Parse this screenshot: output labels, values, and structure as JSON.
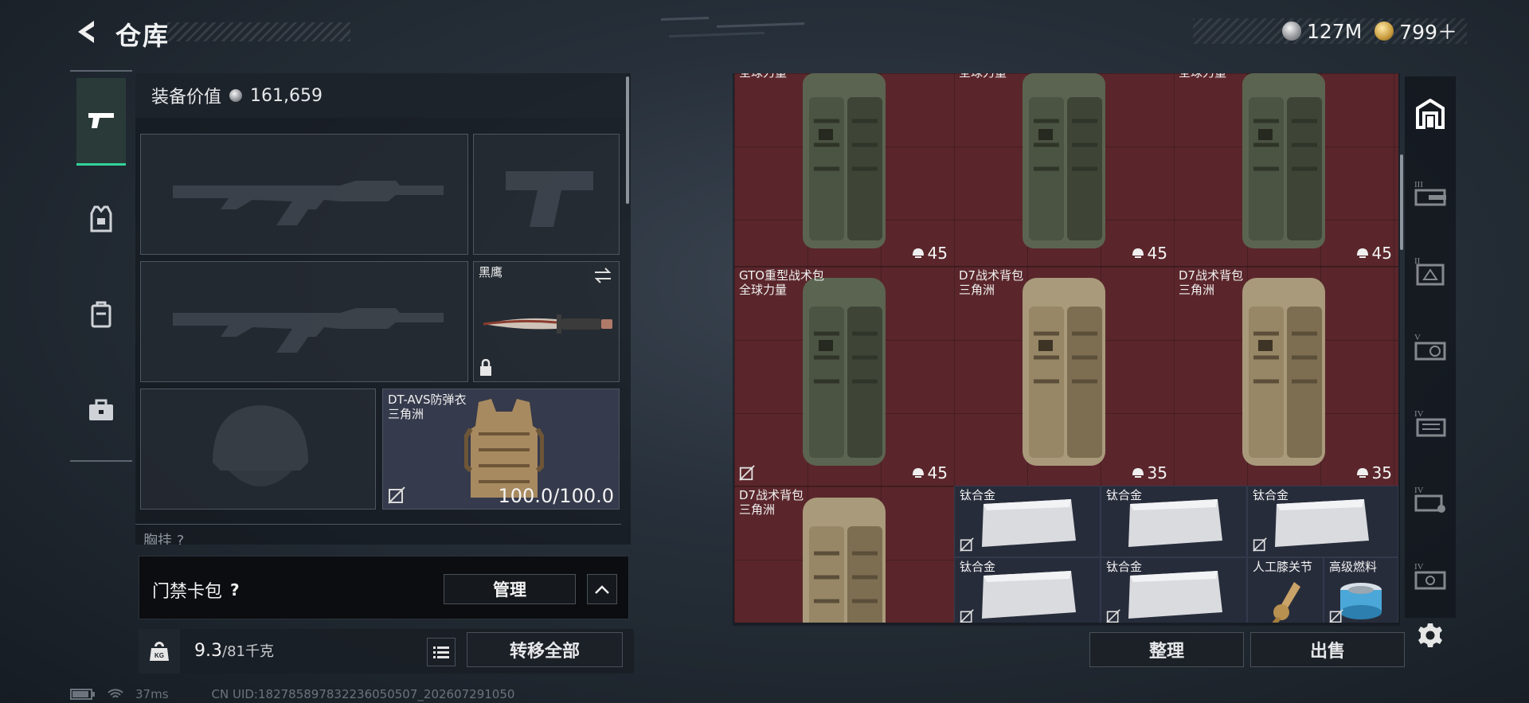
{
  "header": {
    "title": "仓库",
    "currency_silver": "127M",
    "currency_gold": "799＋"
  },
  "left_nav": {
    "items": [
      {
        "name": "weapons",
        "active": true
      },
      {
        "name": "armor",
        "active": false
      },
      {
        "name": "backpack",
        "active": false
      },
      {
        "name": "medkit",
        "active": false
      }
    ]
  },
  "equipment": {
    "value_label": "装备价值",
    "value": "161,659",
    "slots": {
      "primary_weapon_1": {
        "label": ""
      },
      "pistol": {
        "label": ""
      },
      "primary_weapon_2": {
        "label": ""
      },
      "melee": {
        "label": "黑鹰"
      },
      "helmet": {
        "label": ""
      },
      "body_armor": {
        "label": "DT-AVS防弹衣\n三角洲",
        "durability": "100.0/100.0"
      }
    },
    "next_section_label": "胸挂 ?"
  },
  "card_pack": {
    "label": "门禁卡包",
    "help": "?",
    "manage_label": "管理"
  },
  "weight": {
    "current": "9.3",
    "max": "/81千克",
    "badge": "KG"
  },
  "transfer_all_label": "转移全部",
  "footer": {
    "ping": "37ms",
    "uid": "CN UID:18278589783223605050​7_202607291050"
  },
  "storage": {
    "items": [
      {
        "name": "全球力量",
        "capacity": "45",
        "type": "backpack-green"
      },
      {
        "name": "全球力量",
        "capacity": "45",
        "type": "backpack-green"
      },
      {
        "name": "全球力量",
        "capacity": "45",
        "type": "backpack-green"
      },
      {
        "name": "GTO重型战术包\n全球力量",
        "capacity": "45",
        "type": "backpack-green"
      },
      {
        "name": "D7战术背包\n三角洲",
        "capacity": "35",
        "type": "backpack-tan"
      },
      {
        "name": "D7战术背包\n三角洲",
        "capacity": "35",
        "type": "backpack-tan"
      },
      {
        "name": "D7战术背包\n三角洲",
        "capacity": "",
        "type": "backpack-tan"
      },
      {
        "name": "钛合金",
        "type": "ingot"
      },
      {
        "name": "钛合金",
        "type": "ingot"
      },
      {
        "name": "钛合金",
        "type": "ingot"
      },
      {
        "name": "钛合金",
        "type": "ingot"
      },
      {
        "name": "钛合金",
        "type": "ingot"
      },
      {
        "name": "人工膝关节",
        "type": "knee"
      },
      {
        "name": "高级燃料",
        "type": "fuel"
      }
    ],
    "sort_label": "整理",
    "sell_label": "出售"
  },
  "side_tabs": {
    "items": [
      {
        "name": "home",
        "label": ""
      },
      {
        "name": "tier-3-storage-a",
        "label": "III"
      },
      {
        "name": "tier-2-storage",
        "label": "II"
      },
      {
        "name": "tier-5-storage",
        "label": "V"
      },
      {
        "name": "tier-4-storage-a",
        "label": "IV"
      },
      {
        "name": "tier-4-storage-b",
        "label": "IV"
      },
      {
        "name": "tier-4-storage-c",
        "label": "IV"
      }
    ]
  },
  "colors": {
    "accent": "#32d39a",
    "storage_red": "#5a262b",
    "storage_blue": "#272c3b"
  }
}
